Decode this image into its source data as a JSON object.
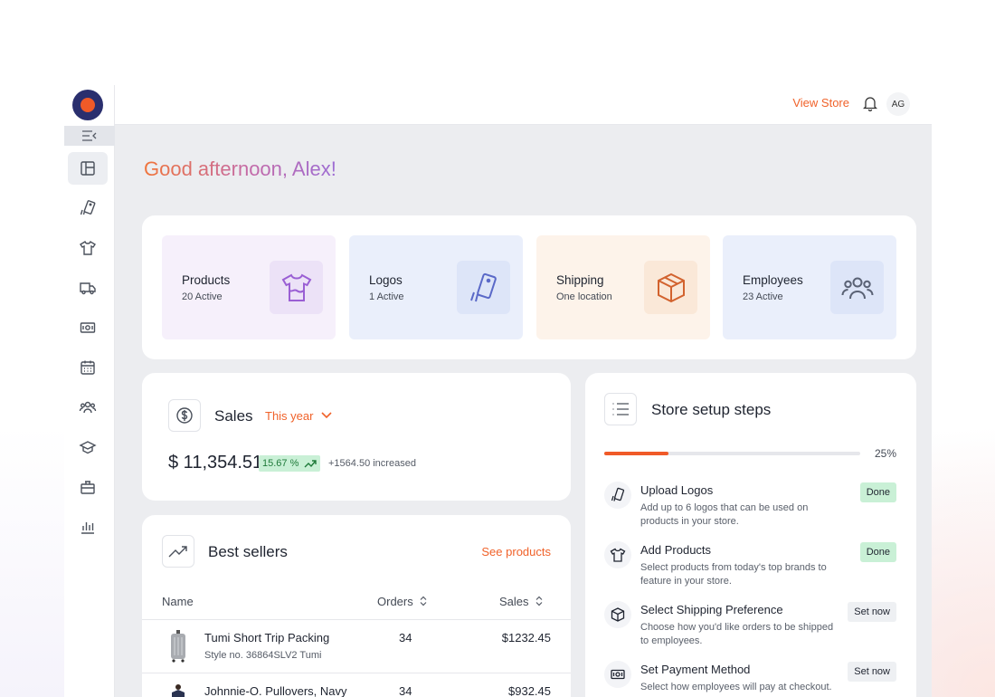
{
  "app": {
    "brand_color": "#f05a28",
    "accent": "#f0622a"
  },
  "topbar": {
    "view_store": "View Store",
    "avatar_initials": "AG",
    "bell_icon": "bell-icon"
  },
  "sidebar": {
    "items": [
      {
        "name": "dashboard",
        "icon": "layout-icon",
        "active": true
      },
      {
        "name": "logos",
        "icon": "tag-icon"
      },
      {
        "name": "products",
        "icon": "shirt-icon"
      },
      {
        "name": "shipping",
        "icon": "truck-icon"
      },
      {
        "name": "payments",
        "icon": "cash-icon"
      },
      {
        "name": "calendar",
        "icon": "calendar-icon"
      },
      {
        "name": "employees",
        "icon": "users-icon"
      },
      {
        "name": "courses",
        "icon": "graduation-icon"
      },
      {
        "name": "gifts",
        "icon": "gift-icon"
      },
      {
        "name": "reports",
        "icon": "bar-chart-icon"
      }
    ]
  },
  "greeting": "Good afternoon, Alex!",
  "stats": [
    {
      "title": "Products",
      "sub": "20 Active",
      "icon": "shirt-icon",
      "bg": "#f6f0fb",
      "box": "#ece2f7",
      "color": "#9a5fd4"
    },
    {
      "title": "Logos",
      "sub": "1 Active",
      "icon": "tag-icon",
      "bg": "#eaeffb",
      "box": "#dde5f8",
      "color": "#5a69c8"
    },
    {
      "title": "Shipping",
      "sub": "One location",
      "icon": "box-icon",
      "bg": "#fdf3ea",
      "box": "#fae8d8",
      "color": "#d2622e"
    },
    {
      "title": "Employees",
      "sub": "23 Active",
      "icon": "users-icon",
      "bg": "#eaeffb",
      "box": "#dde5f8",
      "color": "#5a6275"
    }
  ],
  "sales": {
    "title": "Sales",
    "period": "This year",
    "amount": "$ 11,354.51",
    "change_pct": "15.67 %",
    "increase": "+1564.50 increased"
  },
  "best_sellers": {
    "title": "Best sellers",
    "see_products": "See products",
    "columns": {
      "name": "Name",
      "orders": "Orders",
      "sales": "Sales"
    },
    "rows": [
      {
        "name": "Tumi Short Trip Packing",
        "style": "Style no. 36864SLV2 Tumi",
        "orders": "34",
        "sales": "$1232.45"
      },
      {
        "name": "Johnnie-O. Pullovers, Navy",
        "style": "",
        "orders": "34",
        "sales": "$932.45"
      }
    ]
  },
  "setup": {
    "title": "Store setup steps",
    "progress": 0.25,
    "progress_label": "25%",
    "steps": [
      {
        "title": "Upload Logos",
        "desc": "Add up to 6 logos that can be used on products in your store.",
        "status": "Done",
        "icon": "tag-icon"
      },
      {
        "title": "Add Products",
        "desc": "Select products from today's top brands to feature in your store.",
        "status": "Done",
        "icon": "shirt-icon"
      },
      {
        "title": "Select Shipping Preference",
        "desc": "Choose how you'd like orders to be shipped to employees.",
        "status": "Set now",
        "icon": "box-icon"
      },
      {
        "title": "Set Payment Method",
        "desc": "Select how employees will pay at checkout.",
        "status": "Set now",
        "icon": "cash-icon"
      }
    ]
  }
}
